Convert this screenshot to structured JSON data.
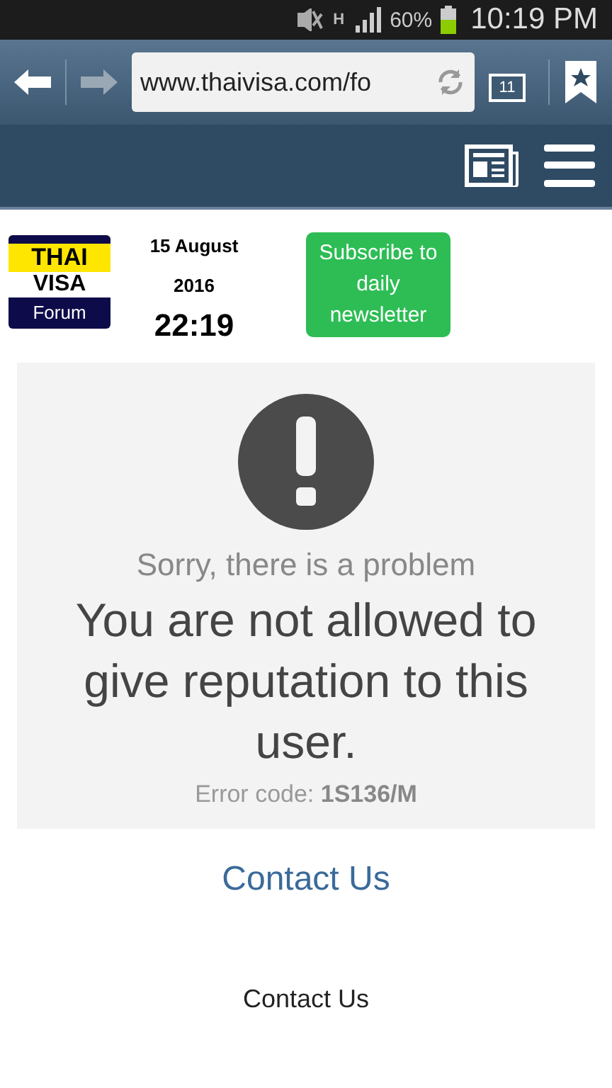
{
  "status_bar": {
    "battery_text": "60%",
    "time": "10:19 PM",
    "network": "H"
  },
  "browser": {
    "url": "www.thaivisa.com/fo",
    "tab_count": "11"
  },
  "header": {
    "logo": {
      "top": "THAI",
      "middle": "VISA",
      "bottom": "Forum"
    },
    "date": "15 August 2016",
    "time": "22:19",
    "subscribe": "Subscribe to daily newsletter"
  },
  "error": {
    "subtitle": "Sorry, there is a problem",
    "message": "You are not allowed to give reputation to this user.",
    "code": "Error code: **1S136/M**"
  },
  "links": [
    "Contact Us",
    "Contact Us"
  ]
}
